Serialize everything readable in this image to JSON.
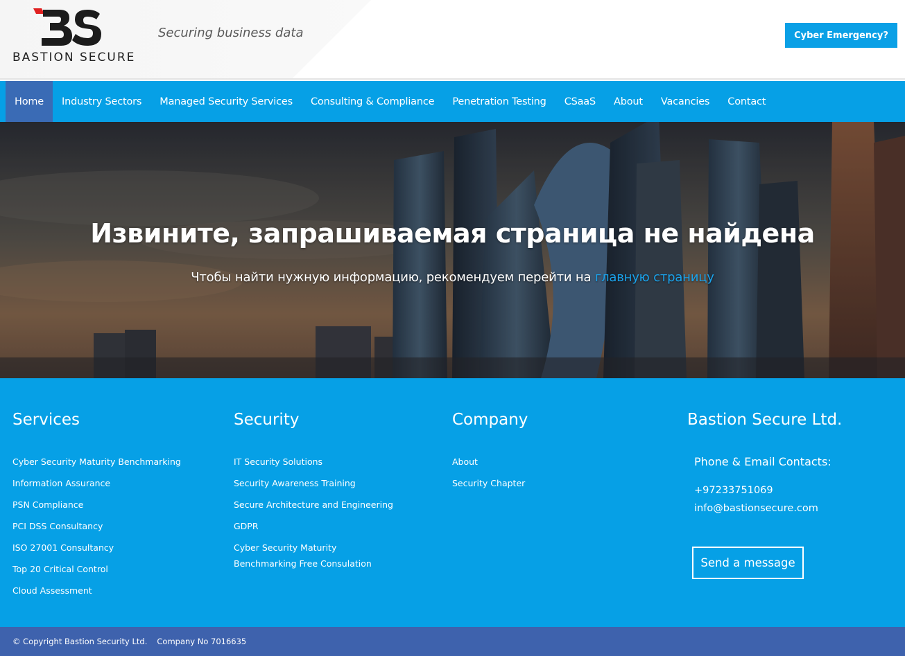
{
  "header": {
    "logo_text": "BASTION SECURE",
    "tagline": "Securing business data",
    "emergency_label": "Cyber Emergency?",
    "accent_color": "#0aa0e6",
    "logo_red": "#e02020"
  },
  "nav": {
    "items": [
      {
        "label": "Home",
        "active": true
      },
      {
        "label": "Industry Sectors"
      },
      {
        "label": "Managed Security Services"
      },
      {
        "label": "Consulting & Compliance"
      },
      {
        "label": "Penetration Testing"
      },
      {
        "label": "CSaaS"
      },
      {
        "label": "About"
      },
      {
        "label": "Vacancies"
      },
      {
        "label": "Contact"
      }
    ]
  },
  "hero": {
    "title": "Извините, запрашиваемая страница не найдена",
    "subtitle_prefix": "Чтобы найти нужную информацию, рекомендуем перейти на ",
    "subtitle_link": "главную страницу"
  },
  "footer": {
    "services": {
      "title": "Services",
      "items": [
        "Cyber Security Maturity Benchmarking",
        "Information Assurance",
        "PSN Compliance",
        "PCI DSS Consultancy",
        "ISO 27001 Consultancy",
        "Top 20 Critical Control",
        "Cloud Assessment"
      ]
    },
    "security": {
      "title": "Security",
      "items": [
        "IT Security Solutions",
        "Security Awareness Training",
        "Secure Architecture and Engineering",
        "GDPR"
      ],
      "last_item_line1": "Cyber Security Maturity",
      "last_item_line2": "Benchmarking Free Consulation"
    },
    "company": {
      "title": "Company",
      "items": [
        "About",
        "Security Chapter"
      ]
    },
    "contacts": {
      "title": "Bastion Secure Ltd.",
      "heading": "Phone & Email Contacts:",
      "phone": "+97233751069",
      "email": "info@bastionsecure.com",
      "send_label": "Send a message"
    }
  },
  "bottom": {
    "copyright": "© Copyright Bastion Security Ltd.",
    "company_no": "Company No 7016635"
  }
}
